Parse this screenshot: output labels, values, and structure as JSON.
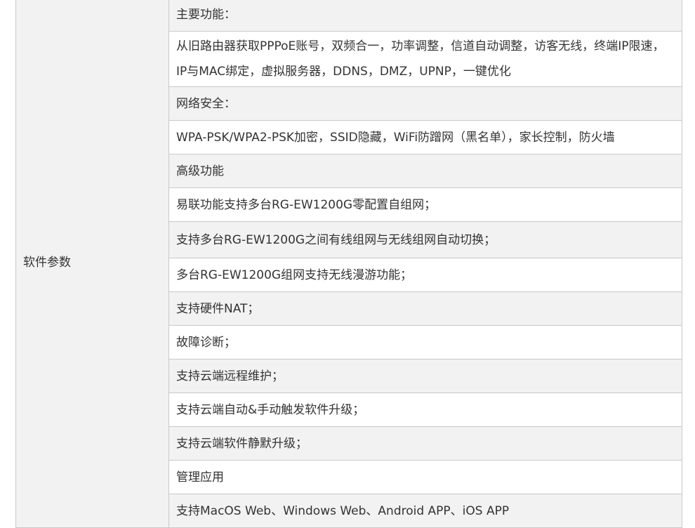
{
  "category_label": "软件参数",
  "rows": [
    {
      "text": "主要功能：",
      "shaded": true
    },
    {
      "text": "从旧路由器获取PPPoE账号，双频合一，功率调整，信道自动调整，访客无线，终端IP限速，IP与MAC绑定，虚拟服务器，DDNS，DMZ，UPNP，一键优化",
      "shaded": false
    },
    {
      "text": "网络安全：",
      "shaded": true
    },
    {
      "text": "WPA-PSK/WPA2-PSK加密，SSID隐藏，WiFi防蹭网（黑名单），家长控制，防火墙",
      "shaded": false
    },
    {
      "text": "高级功能",
      "shaded": true
    },
    {
      "text": "易联功能支持多台RG-EW1200G零配置自组网；",
      "shaded": false
    },
    {
      "text": "支持多台RG-EW1200G之间有线组网与无线组网自动切换；",
      "shaded": true
    },
    {
      "text": "多台RG-EW1200G组网支持无线漫游功能；",
      "shaded": false
    },
    {
      "text": "支持硬件NAT；",
      "shaded": true
    },
    {
      "text": "故障诊断；",
      "shaded": false
    },
    {
      "text": "支持云端远程维护；",
      "shaded": true
    },
    {
      "text": "支持云端自动&手动触发软件升级；",
      "shaded": false
    },
    {
      "text": "支持云端软件静默升级；",
      "shaded": true
    },
    {
      "text": "管理应用",
      "shaded": false
    },
    {
      "text": "支持MacOS Web、Windows Web、Android APP、iOS APP",
      "shaded": true
    }
  ]
}
